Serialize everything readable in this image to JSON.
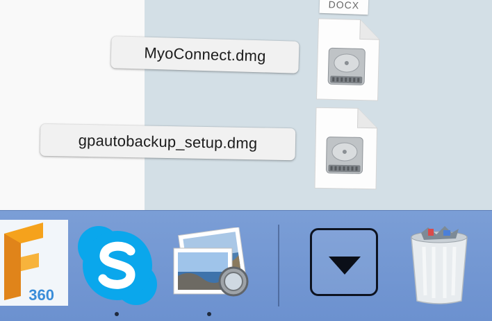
{
  "stack": {
    "top_file": {
      "label": "DOCX",
      "type": "docx",
      "icon": "document-icon"
    },
    "files": [
      {
        "label": "MyoConnect.dmg",
        "type": "dmg",
        "icon": "disk-image-icon"
      },
      {
        "label": "gpautobackup_setup.dmg",
        "type": "dmg",
        "icon": "disk-image-icon"
      }
    ]
  },
  "dock": {
    "apps": [
      {
        "name": "Fusion 360",
        "icon": "fusion-360-icon",
        "badge_text": "360",
        "running": false
      },
      {
        "name": "Skype",
        "icon": "skype-icon",
        "running": true
      },
      {
        "name": "Preview",
        "icon": "preview-icon",
        "running": true
      }
    ],
    "stack_toggle": {
      "icon": "triangle-down-icon"
    },
    "trash": {
      "icon": "trash-full-icon"
    }
  },
  "colors": {
    "dock": "#7b9ed6",
    "fan_background": "#d3dfe6",
    "skype_blue": "#0aa7ec",
    "fusion_orange": "#f5a21c"
  }
}
